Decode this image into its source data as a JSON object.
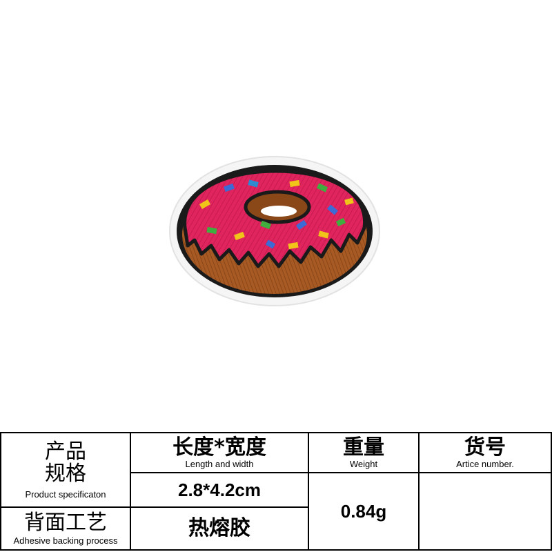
{
  "product": {
    "name": "donut embroidered patch",
    "colors": {
      "frosting": "#e0245e",
      "dough": "#a85a24",
      "border": "#1a1a1a",
      "felt": "#f7f7f7"
    }
  },
  "spec_table": {
    "spec_label_zh_line1": "产品",
    "spec_label_zh_line2": "规格",
    "spec_label_en": "Product specificaton",
    "size_header_zh": "长度*宽度",
    "size_header_en": "Length and width",
    "size_value": "2.8*4.2cm",
    "weight_header_zh": "重量",
    "weight_header_en": "Weight",
    "weight_value": "0.84g",
    "article_header_zh": "货号",
    "article_header_en": "Artice number.",
    "article_value": "",
    "backing_label_zh": "背面工艺",
    "backing_label_en": "Adhesive backing process",
    "backing_value": "热熔胶"
  }
}
